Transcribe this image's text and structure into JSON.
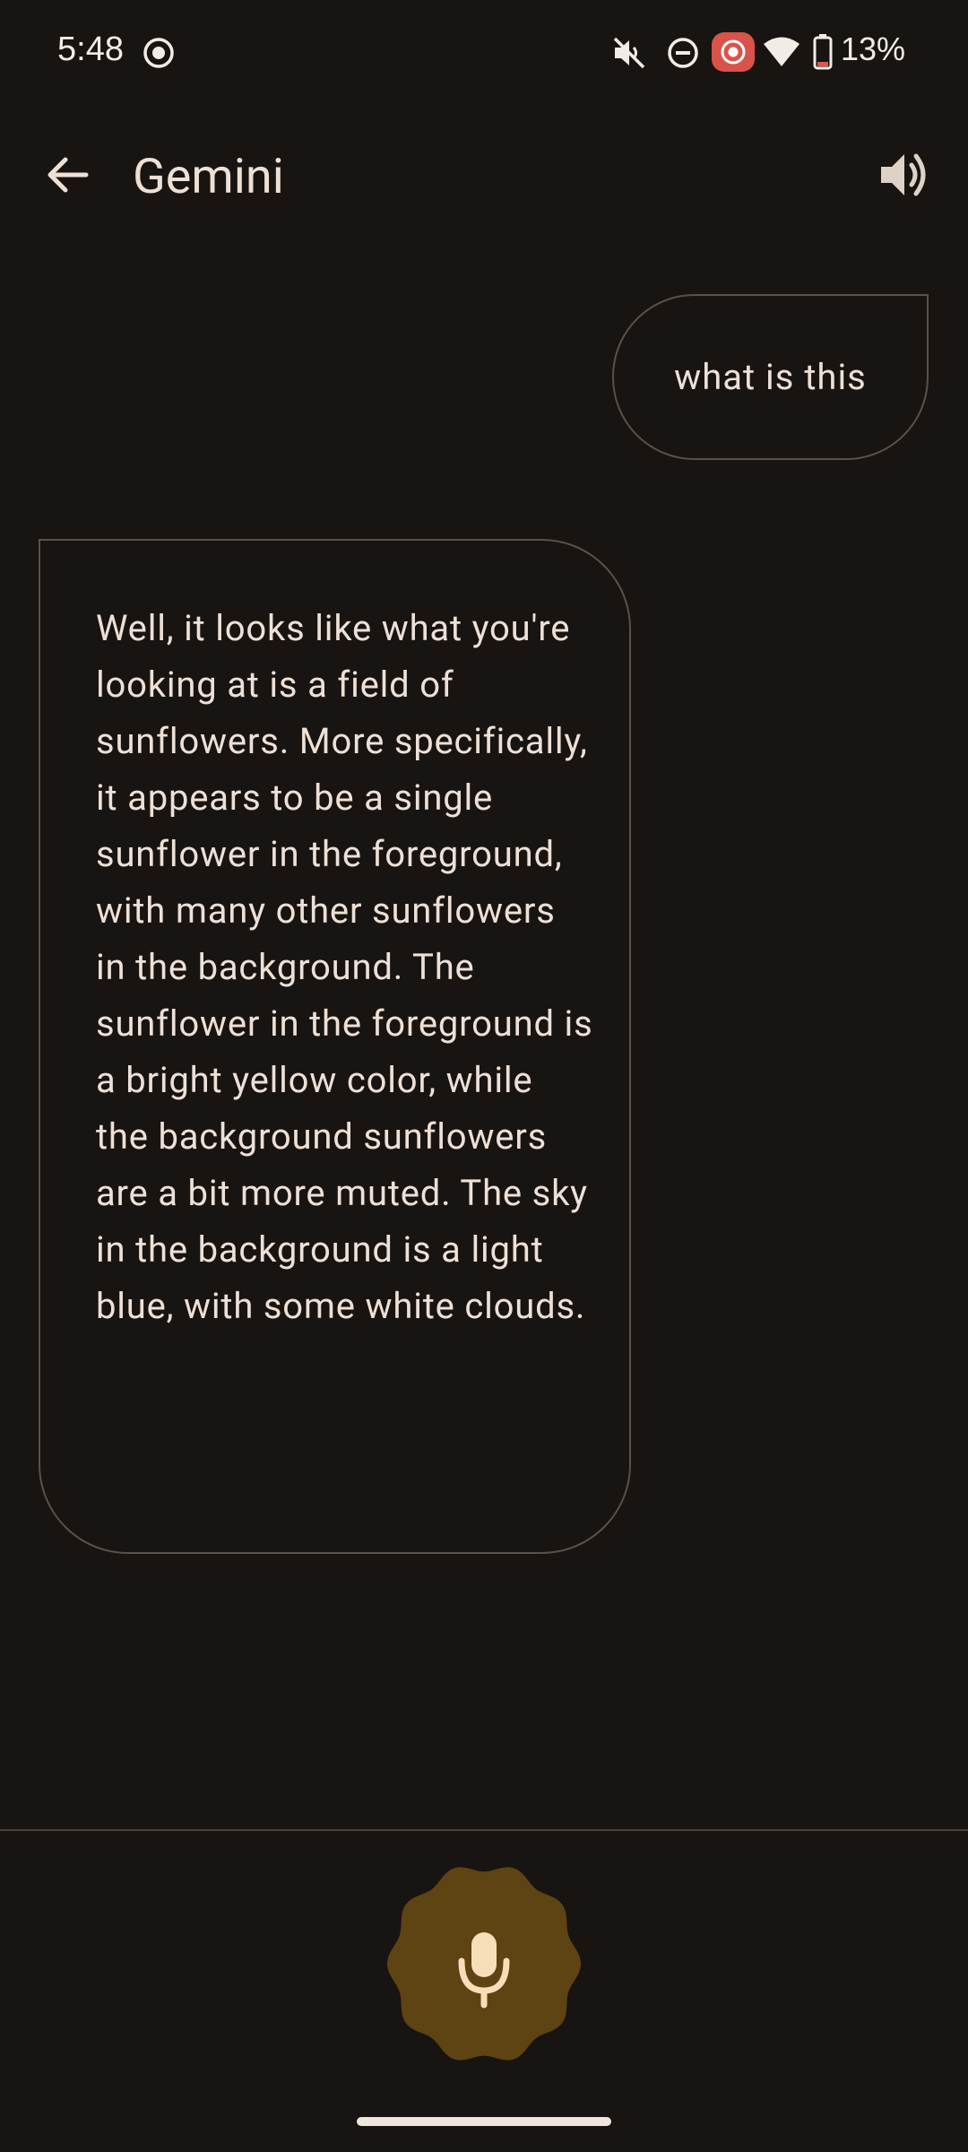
{
  "status_bar": {
    "time": "5:48",
    "battery_percent": "13%",
    "icons": [
      "screen-record-icon",
      "mute-icon",
      "do-not-disturb-icon",
      "recording-icon",
      "wifi-icon",
      "battery-icon"
    ]
  },
  "app_bar": {
    "title": "Gemini",
    "back_icon": "arrow-left-icon",
    "speaker_icon": "speaker-icon"
  },
  "conversation": {
    "user_message": "what is this",
    "assistant_message": "Well, it looks like what you're looking at is a field of sunflowers. More specifically, it appears to be a single sunflower in the foreground, with many other sunflowers in the background. The sunflower in the foreground is a bright yellow color, while the background sunflowers are a bit more muted. The sky in the background is a light blue, with some white clouds."
  },
  "input": {
    "mic_icon": "microphone-icon"
  },
  "colors": {
    "background": "#181411",
    "text": "#ede0d6",
    "bubble_border": "#5a5149",
    "mic_button": "#5e4313",
    "mic_icon": "#f6dfb8",
    "recording_badge": "#d9534a"
  }
}
